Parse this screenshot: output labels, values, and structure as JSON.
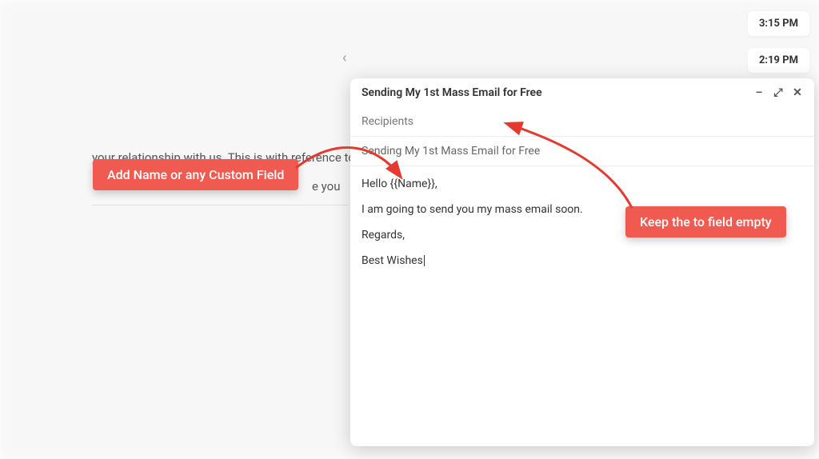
{
  "times": {
    "t1": "3:15 PM",
    "t2": "2:19 PM"
  },
  "bg": {
    "line1": "your relationship with us. This is with reference to y",
    "line2": "e you"
  },
  "compose": {
    "title": "Sending My 1st Mass Email for Free",
    "recipients_placeholder": "Recipients",
    "subject": "Sending My 1st Mass Email for Free",
    "body": {
      "greeting": "Hello {{Name}},",
      "line1": "I am going to send you my mass email soon.",
      "regards": "Regards,",
      "signature": "Best Wishes"
    }
  },
  "callouts": {
    "add_name": "Add Name or any Custom Field",
    "keep_empty": "Keep the to field empty"
  }
}
